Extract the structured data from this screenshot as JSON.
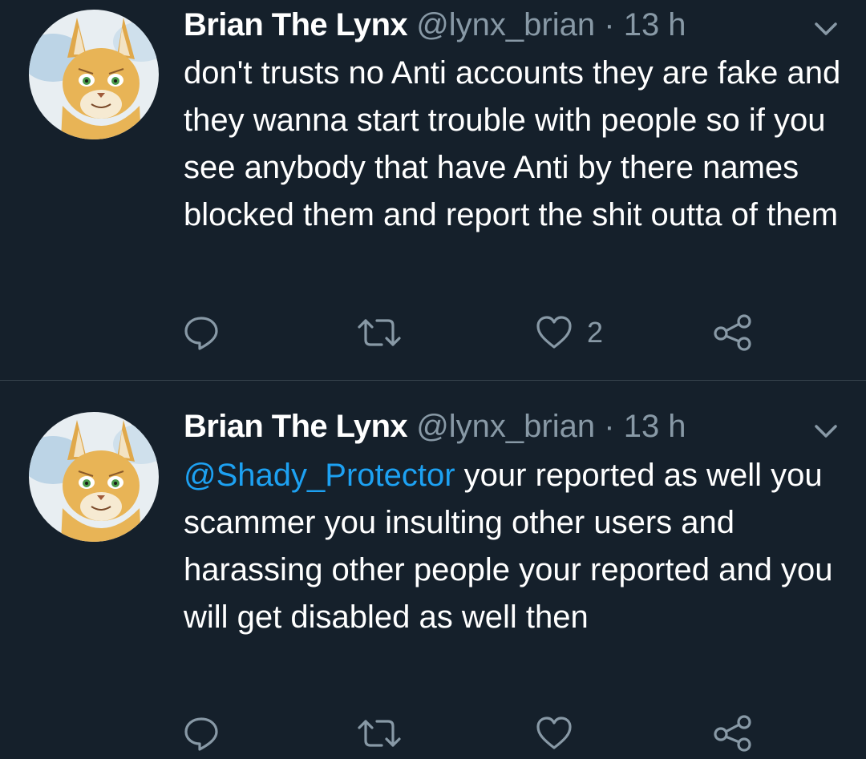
{
  "tweets": [
    {
      "author_name": "Brian The Lynx",
      "handle": "@lynx_brian",
      "separator": "·",
      "time": "13 h",
      "mention": "",
      "text": "don't trusts no Anti accounts they are fake and they wanna start trouble with people so if you see anybody that have Anti by there names blocked them and report the shit outta of them",
      "like_count": "2",
      "icons": [
        "reply-icon",
        "retweet-icon",
        "like-icon",
        "share-icon",
        "chevron-down-icon"
      ]
    },
    {
      "author_name": "Brian The Lynx",
      "handle": "@lynx_brian",
      "separator": "·",
      "time": "13 h",
      "mention": "@Shady_Protector",
      "text": " your reported as well you scammer you insulting other users and harassing other people your reported and you will get disabled as well then",
      "like_count": "",
      "icons": [
        "reply-icon",
        "retweet-icon",
        "like-icon",
        "share-icon",
        "chevron-down-icon"
      ]
    }
  ],
  "colors": {
    "background": "#15202b",
    "text": "#ffffff",
    "secondary": "#8899a6",
    "link": "#1da1f2",
    "divider": "#38444d"
  }
}
